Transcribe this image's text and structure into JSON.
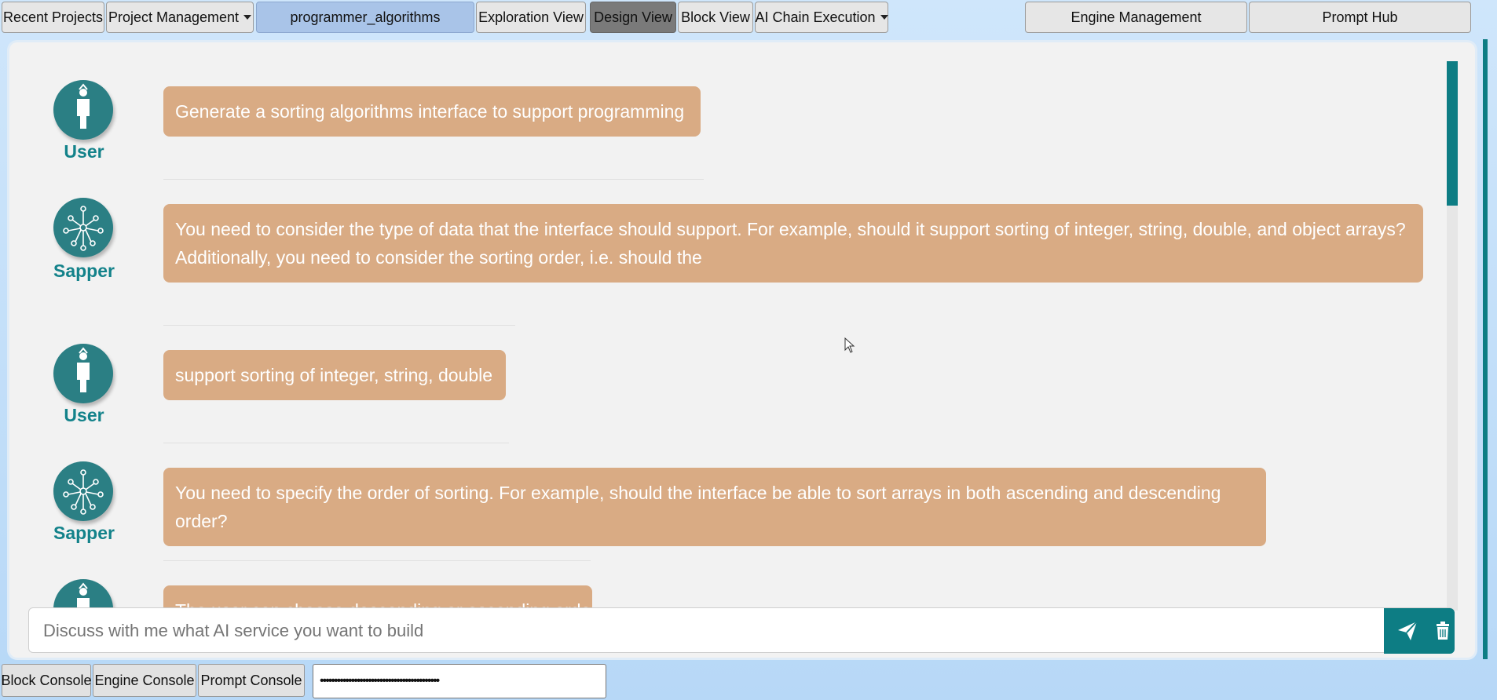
{
  "topbar": {
    "recent_projects": "Recent Projects",
    "project_management": "Project Management",
    "project_name": "programmer_algorithms",
    "exploration_view": "Exploration View",
    "design_view": "Design View",
    "block_view": "Block View",
    "ai_chain_execution": "AI Chain Execution",
    "engine_management": "Engine Management",
    "prompt_hub": "Prompt Hub"
  },
  "chat": {
    "messages": [
      {
        "role": "User",
        "text": "Generate a sorting algorithms interface to support programming"
      },
      {
        "role": "Sapper",
        "text": "You need to consider the type of data that the interface should support. For example, should it support sorting of integer, string, double, and object arrays? Additionally, you need to consider the sorting order, i.e. should the"
      },
      {
        "role": "User",
        "text": "support sorting of integer, string, double"
      },
      {
        "role": "Sapper",
        "text": "You need to specify the order of sorting. For example, should the interface be able to sort arrays in both ascending and descending order?"
      },
      {
        "role": "User",
        "text": "The user can choose descending or ascending order"
      }
    ],
    "input_placeholder": "Discuss with me what AI service you want to build"
  },
  "bottombar": {
    "block_console": "Block Console",
    "engine_console": "Engine Console",
    "prompt_console": "Prompt Console",
    "masked_value": "••••••••••••••••••••••••••••••••••••••••••"
  },
  "colors": {
    "accent": "#0d7d84",
    "bubble": "#d9ab84",
    "role_label": "#13828a"
  }
}
